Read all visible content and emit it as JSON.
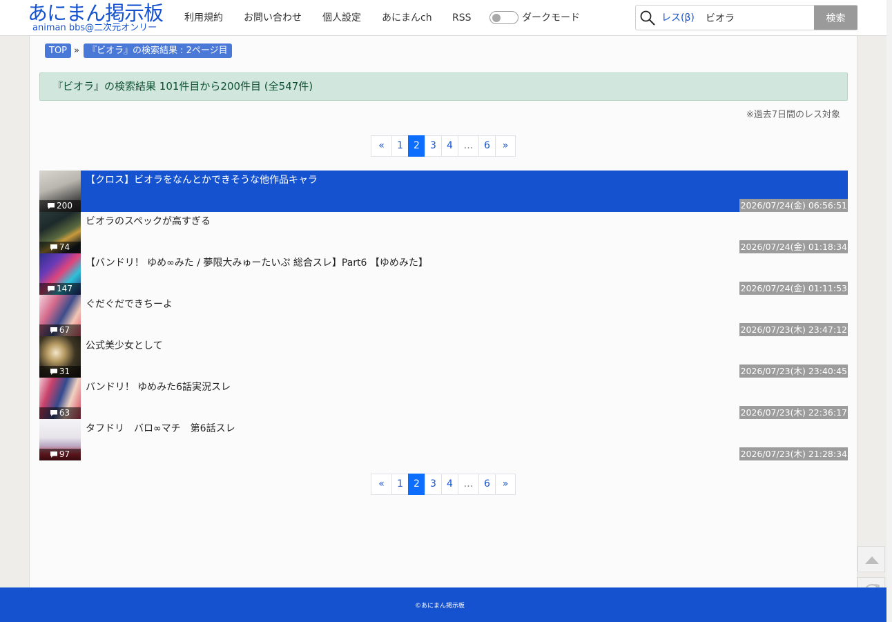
{
  "header": {
    "logo_main": "あにまん掲示板",
    "logo_sub": "animan bbs@二次元オンリー",
    "nav": [
      "利用規約",
      "お問い合わせ",
      "個人設定",
      "あにまんch",
      "RSS"
    ],
    "dark_mode_label": "ダークモード",
    "search_scope": "レス(β)",
    "search_value": "ビオラ",
    "search_button": "検索"
  },
  "breadcrumb": {
    "top": "TOP",
    "separator": "»",
    "current": "『ビオラ』の検索結果 : 2ページ目"
  },
  "result_banner": "『ビオラ』の検索結果 101件目から200件目 (全547件)",
  "note": "※過去7日間のレス対象",
  "pagination": {
    "prev": "«",
    "pages": [
      "1",
      "2",
      "3",
      "4",
      "…",
      "6"
    ],
    "current": "2",
    "next": "»"
  },
  "threads": [
    {
      "title": "【クロス】ビオラをなんとかできそうな他作品キャラ",
      "count": "200",
      "date": "2026/07/24(金) 06:56:51"
    },
    {
      "title": "ビオラのスペックが高すぎる",
      "count": "74",
      "date": "2026/07/24(金) 01:18:34"
    },
    {
      "title": "【バンドリ！ ゆめ∞みた / 夢限大みゅーたいぷ 総合スレ】Part6 【ゆめみた】",
      "count": "147",
      "date": "2026/07/24(金) 01:11:53"
    },
    {
      "title": "ぐだぐだできちーよ",
      "count": "67",
      "date": "2026/07/23(木) 23:47:12"
    },
    {
      "title": "公式美少女として",
      "count": "31",
      "date": "2026/07/23(木) 23:40:45"
    },
    {
      "title": "バンドリ！ ゆめみた6話実況スレ",
      "count": "63",
      "date": "2026/07/23(木) 22:36:17"
    },
    {
      "title": "タフドリ　バロ∞マチ　第6話スレ",
      "count": "97",
      "date": "2026/07/23(木) 21:28:34"
    }
  ],
  "footer": "©あにまん掲示板",
  "colors": {
    "brand": "#1552d0",
    "selected_row": "#1552d0",
    "active_page": "#0d6efd",
    "banner_bg": "#d1e7dd",
    "banner_text": "#0f5132",
    "date_bg": "#9c9c9c"
  }
}
